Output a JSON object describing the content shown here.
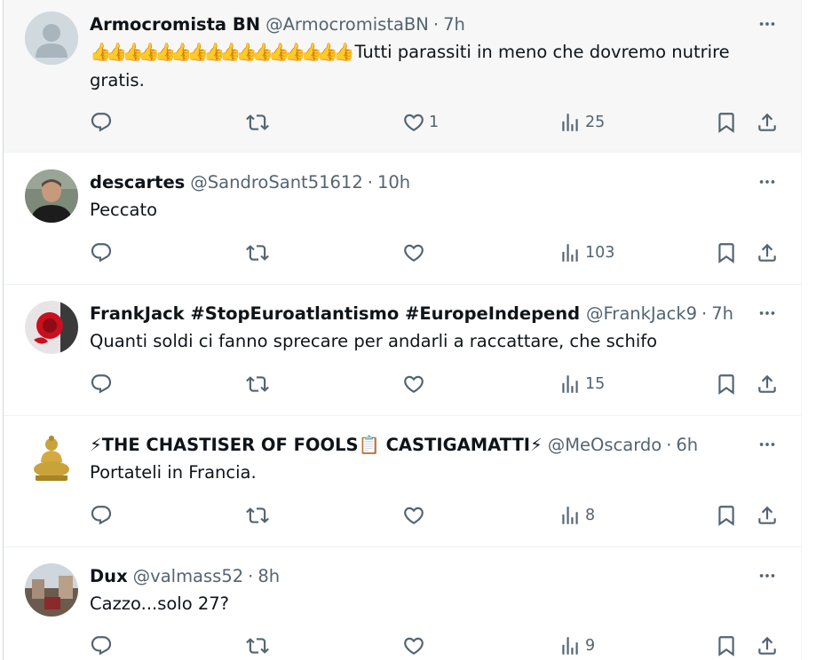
{
  "tweets": [
    {
      "name": "Armocromista BN",
      "handle": "@ArmocromistaBN",
      "time": "7h",
      "emoji": "👍👍👍👍👍👍👍👍👍👍👍👍👍👍👍👍",
      "text": "Tutti parassiti in meno che dovremo nutrire gratis.",
      "likes": "1",
      "views": "25",
      "avatar": "default-avatar"
    },
    {
      "name": "descartes",
      "handle": "@SandroSant51612",
      "time": "10h",
      "text": "Peccato",
      "likes": "",
      "views": "103",
      "avatar": "man-photo"
    },
    {
      "name": "FrankJack #StopEuroatlantismo #EuropeIndependent",
      "handle": "@FrankJack9",
      "time": "7h",
      "text": "Quanti soldi ci fanno sprecare per andarli a raccattare, che schifo",
      "likes": "",
      "views": "15",
      "avatar": "red-rose-photo"
    },
    {
      "name": "⚡THE CHASTISER OF FOOLS📋 CASTIGAMATTI⚡",
      "handle": "@MeOscardo",
      "time": "6h",
      "text": "Portateli in Francia.",
      "likes": "",
      "views": "8",
      "avatar": "golden-buddha"
    },
    {
      "name": "Dux",
      "handle": "@valmass52",
      "time": "8h",
      "text": "Cazzo...solo 27?",
      "likes": "",
      "views": "9",
      "avatar": "street-photo"
    }
  ],
  "separator": "·",
  "colors": {
    "text": "#0f1419",
    "secondary": "#536471",
    "hover_bg": "#f7f7f7",
    "border": "#eff3f4"
  }
}
